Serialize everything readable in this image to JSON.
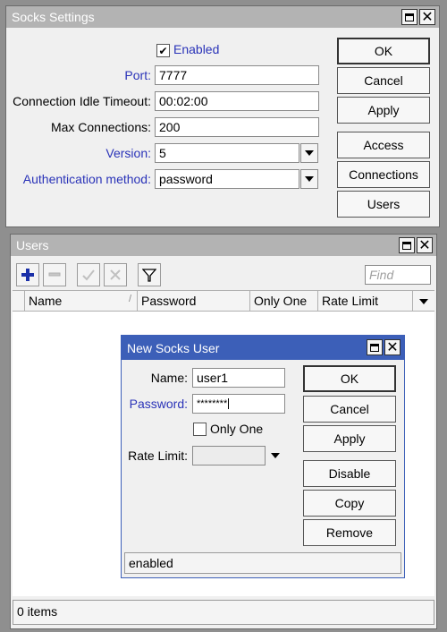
{
  "socks_settings": {
    "title": "Socks Settings",
    "enabled_label": "Enabled",
    "enabled_checked": true,
    "port_label": "Port:",
    "port_value": "7777",
    "idle_timeout_label": "Connection Idle Timeout:",
    "idle_timeout_value": "00:02:00",
    "max_connections_label": "Max Connections:",
    "max_connections_value": "200",
    "version_label": "Version:",
    "version_value": "5",
    "auth_method_label": "Authentication method:",
    "auth_method_value": "password",
    "buttons": {
      "ok": "OK",
      "cancel": "Cancel",
      "apply": "Apply",
      "access": "Access",
      "connections": "Connections",
      "users": "Users"
    }
  },
  "users_window": {
    "title": "Users",
    "find_placeholder": "Find",
    "columns": [
      "Name",
      "Password",
      "Only One",
      "Rate Limit"
    ],
    "status": "0 items"
  },
  "new_user_dialog": {
    "title": "New Socks User",
    "name_label": "Name:",
    "name_value": "user1",
    "password_label": "Password:",
    "password_value": "********",
    "only_one_label": "Only One",
    "rate_limit_label": "Rate Limit:",
    "rate_limit_value": "",
    "status": "enabled",
    "buttons": {
      "ok": "OK",
      "cancel": "Cancel",
      "apply": "Apply",
      "disable": "Disable",
      "copy": "Copy",
      "remove": "Remove"
    }
  }
}
